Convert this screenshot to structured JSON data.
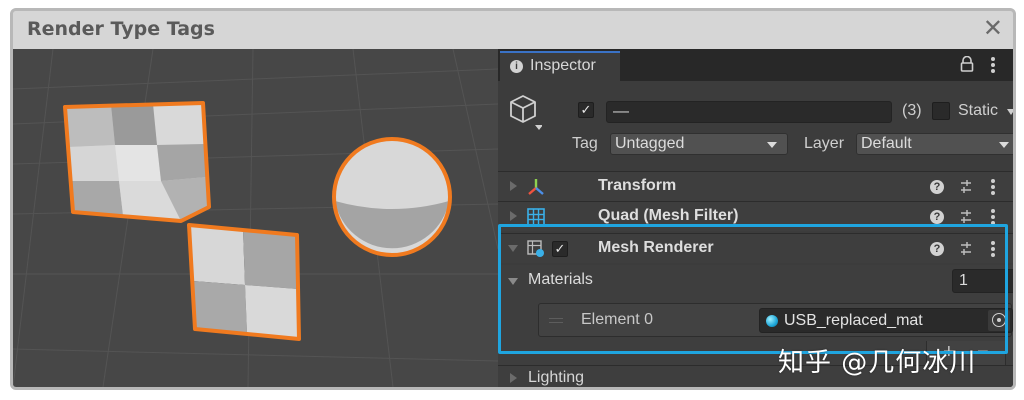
{
  "window": {
    "title": "Render Type Tags",
    "close_icon": "close-icon"
  },
  "colors": {
    "outline_orange": "#f07a1f",
    "highlight_blue": "#1fa5e0",
    "scene_bg": "#474747",
    "inspector_bg": "#3c3c3c"
  },
  "inspector": {
    "tab_label": "Inspector",
    "object": {
      "active_check": "✓",
      "name_value": "—",
      "count": "(3)",
      "static_label": "Static",
      "tag_label": "Tag",
      "tag_value": "Untagged",
      "layer_label": "Layer",
      "layer_value": "Default"
    },
    "components": [
      {
        "label": "Transform",
        "icon": "transform-icon"
      },
      {
        "label": "Quad (Mesh Filter)",
        "icon": "mesh-filter-icon"
      },
      {
        "label": "Mesh Renderer",
        "icon": "mesh-renderer-icon",
        "enabled_check": "✓"
      }
    ],
    "materials": {
      "label": "Materials",
      "count": "1",
      "element_label": "Element 0",
      "element_value": "USB_replaced_mat",
      "plus": "+",
      "minus": "−"
    },
    "lighting_label": "Lighting"
  },
  "watermark": "知乎 @几何冰川"
}
